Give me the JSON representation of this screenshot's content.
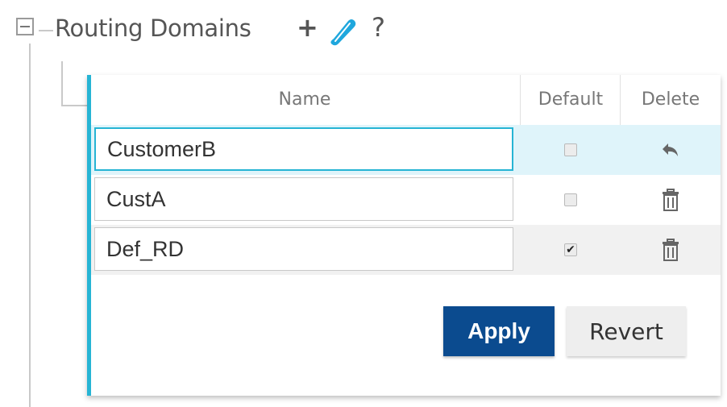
{
  "section": {
    "title": "Routing Domains",
    "help_label": "?",
    "add_label": "+"
  },
  "table": {
    "columns": [
      "Name",
      "Default",
      "Delete"
    ],
    "rows": [
      {
        "name": "CustomerB",
        "default": false,
        "delete_action": "undo-icon",
        "state": "editing"
      },
      {
        "name": "CustA",
        "default": false,
        "delete_action": "trash-icon",
        "state": "normal"
      },
      {
        "name": "Def_RD",
        "default": true,
        "delete_action": "trash-icon",
        "state": "normal"
      }
    ],
    "check_mark": "✔"
  },
  "buttons": {
    "apply_label": "Apply",
    "revert_label": "Revert"
  },
  "colors": {
    "accent": "#26b4d4",
    "primary_button": "#0b4b8f",
    "selected_row": "#dff4fa"
  }
}
